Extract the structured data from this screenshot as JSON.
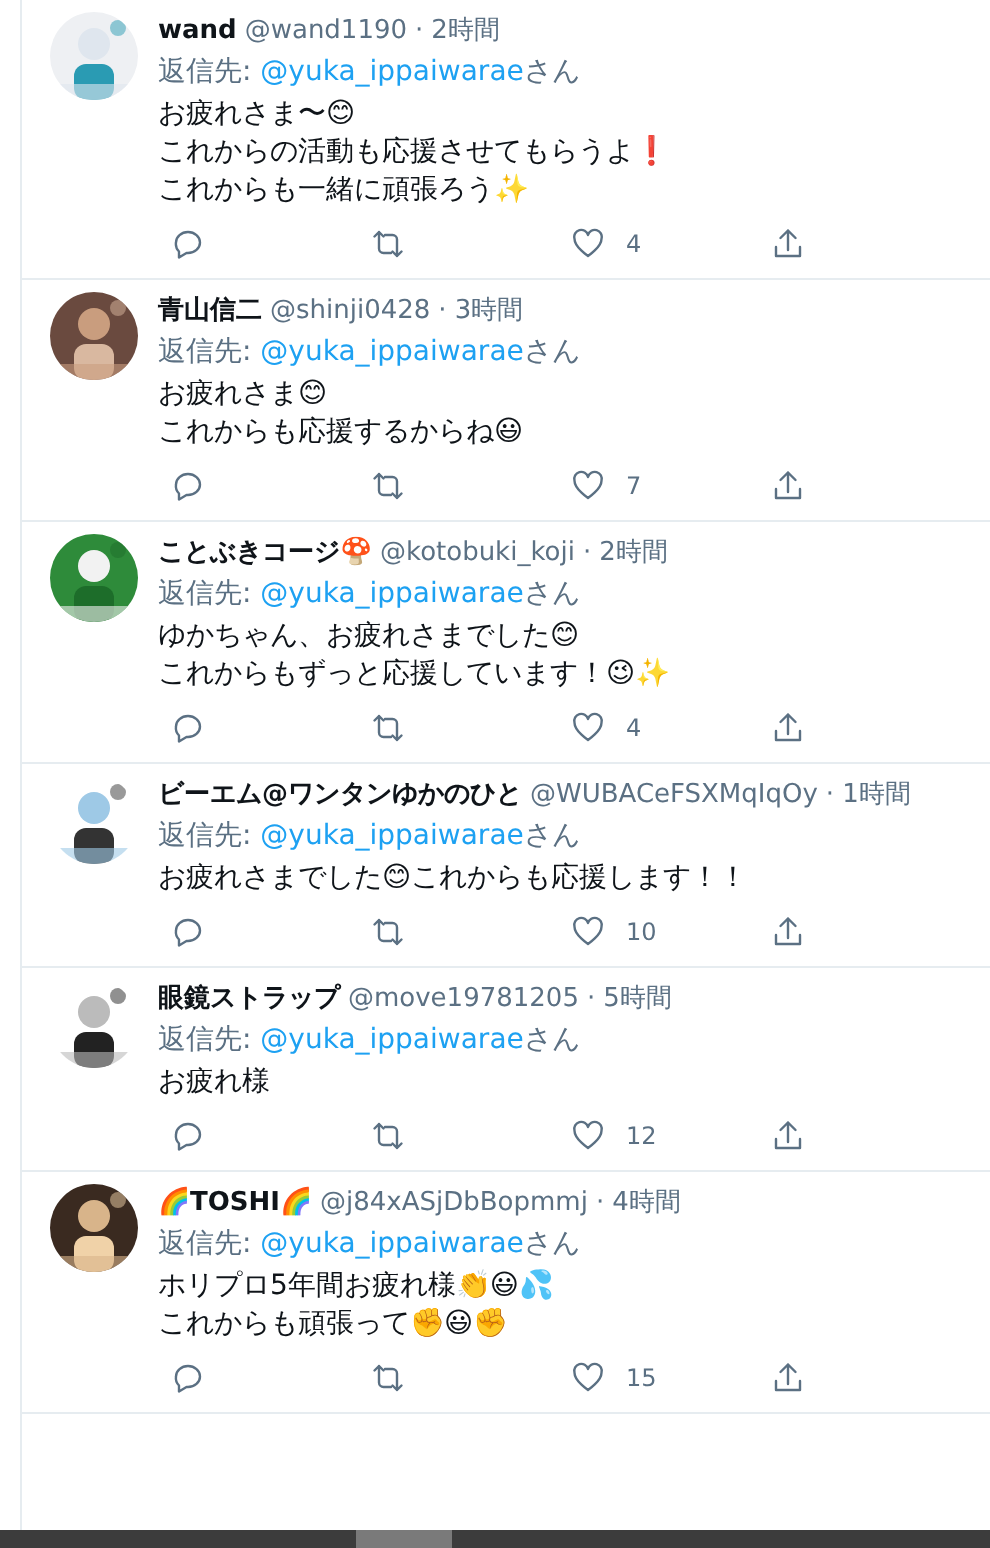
{
  "tweets": [
    {
      "name": "wand",
      "handle": "@wand1190",
      "separator": "·",
      "time": "2時間",
      "reply_prefix": "返信先: ",
      "mention": "@yuka_ippaiwarae",
      "reply_suffix": "さん",
      "lines": [
        "お疲れさま〜😊",
        "これからの活動も応援させてもらうよ❗",
        "これからも一緒に頑張ろう✨"
      ],
      "likes": "4",
      "avatar": {
        "kind": "picture"
      }
    },
    {
      "name": "青山信二",
      "handle": "@shinji0428",
      "separator": "·",
      "time": "3時間",
      "reply_prefix": "返信先: ",
      "mention": "@yuka_ippaiwarae",
      "reply_suffix": "さん",
      "lines": [
        "お疲れさま😊",
        "これからも応援するからね😃"
      ],
      "likes": "7",
      "avatar": {
        "kind": "picture"
      }
    },
    {
      "name": "ことぶきコージ🍄",
      "handle": "@kotobuki_koji",
      "separator": "·",
      "time": "2時間",
      "reply_prefix": "返信先: ",
      "mention": "@yuka_ippaiwarae",
      "reply_suffix": "さん",
      "lines": [
        "ゆかちゃん、お疲れさまでした😊",
        "これからもずっと応援しています！😉✨"
      ],
      "likes": "4",
      "avatar": {
        "kind": "picture"
      }
    },
    {
      "name": "ビーエム@ワンタンゆかのひと",
      "handle": "@WUBACeFSXMqIqOy",
      "separator": "·",
      "time": "1時間",
      "reply_prefix": "返信先: ",
      "mention": "@yuka_ippaiwarae",
      "reply_suffix": "さん",
      "lines": [
        "お疲れさまでした😊これからも応援します！！"
      ],
      "likes": "10",
      "avatar": {
        "kind": "picture"
      }
    },
    {
      "name": "眼鏡ストラップ",
      "handle": "@move19781205",
      "separator": "·",
      "time": "5時間",
      "reply_prefix": "返信先: ",
      "mention": "@yuka_ippaiwarae",
      "reply_suffix": "さん",
      "lines": [
        "お疲れ様"
      ],
      "likes": "12",
      "avatar": {
        "kind": "picture"
      }
    },
    {
      "name": "🌈TOSHI🌈",
      "handle": "@j84xASjDbBopmmj",
      "separator": "·",
      "time": "4時間",
      "reply_prefix": "返信先: ",
      "mention": "@yuka_ippaiwarae",
      "reply_suffix": "さん",
      "lines": [
        "ホリプロ5年間お疲れ様👏😃💦",
        "これからも頑張って✊😃✊"
      ],
      "likes": "15",
      "avatar": {
        "kind": "picture"
      }
    }
  ]
}
